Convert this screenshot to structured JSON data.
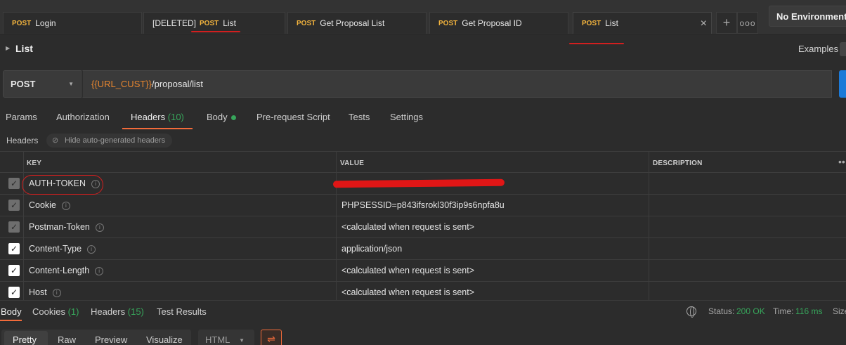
{
  "tabs": [
    {
      "method": "POST",
      "prefix": "",
      "title": "Login"
    },
    {
      "method": "POST",
      "prefix": "[DELETED]",
      "title": "List"
    },
    {
      "method": "POST",
      "prefix": "",
      "title": "Get Proposal List"
    },
    {
      "method": "POST",
      "prefix": "",
      "title": "Get Proposal ID"
    },
    {
      "method": "POST",
      "prefix": "",
      "title": "List",
      "close_icon": "×"
    }
  ],
  "tab_actions": {
    "add": "+",
    "more": "ooo"
  },
  "environment": {
    "selected": "No Environment"
  },
  "request": {
    "name": "List",
    "examples_label": "Examples"
  },
  "url_bar": {
    "method": "POST",
    "url_variable": "{{URL_CUST}}",
    "url_path": "/proposal/list"
  },
  "request_tabs": {
    "params": "Params",
    "authorization": "Authorization",
    "headers": "Headers",
    "headers_count": "(10)",
    "body": "Body",
    "prerequest": "Pre-request Script",
    "tests": "Tests",
    "settings": "Settings"
  },
  "headers_section": {
    "label": "Headers",
    "hide_auto": "Hide auto-generated headers"
  },
  "table": {
    "columns": {
      "key": "KEY",
      "value": "VALUE",
      "description": "DESCRIPTION"
    },
    "rows": [
      {
        "key": "AUTH-TOKEN",
        "value": "",
        "checked": true,
        "auto": true
      },
      {
        "key": "Cookie",
        "value": "PHPSESSID=p843ifsrokl30f3ip9s6npfa8u",
        "checked": true,
        "auto": true
      },
      {
        "key": "Postman-Token",
        "value": "<calculated when request is sent>",
        "checked": true,
        "auto": true
      },
      {
        "key": "Content-Type",
        "value": "application/json",
        "checked": true,
        "auto": false
      },
      {
        "key": "Content-Length",
        "value": "<calculated when request is sent>",
        "checked": true,
        "auto": false
      },
      {
        "key": "Host",
        "value": "<calculated when request is sent>",
        "checked": true,
        "auto": false
      }
    ]
  },
  "response_tabs": {
    "body": "Body",
    "cookies": "Cookies",
    "cookies_count": "(1)",
    "headers": "Headers",
    "headers_count": "(15)",
    "test_results": "Test Results"
  },
  "response_status": {
    "status_label": "Status:",
    "status_value": "200 OK",
    "time_label": "Time:",
    "time_value": "116 ms",
    "size_label": "Size"
  },
  "response_view": {
    "pretty": "Pretty",
    "raw": "Raw",
    "preview": "Preview",
    "visualize": "Visualize",
    "format": "HTML"
  },
  "colors": {
    "method_post": "#f2b33d",
    "accent_orange": "#f26b3a",
    "green": "#37a65b",
    "send_blue": "#1c7ad8",
    "annotation_red": "#d21f1f"
  }
}
